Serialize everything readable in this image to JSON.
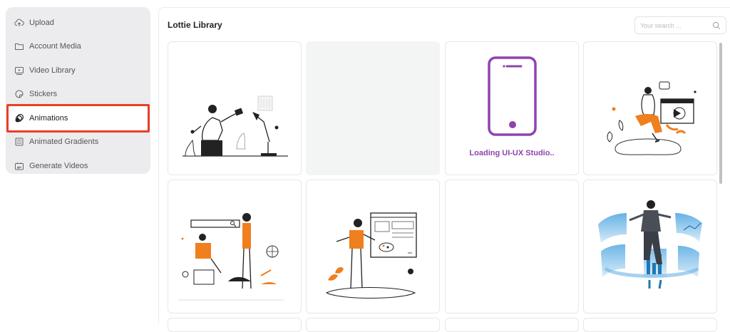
{
  "sidebar": {
    "items": [
      {
        "label": "Upload",
        "icon": "cloud-upload-icon"
      },
      {
        "label": "Account Media",
        "icon": "folder-icon"
      },
      {
        "label": "Video Library",
        "icon": "video-library-icon"
      },
      {
        "label": "Stickers",
        "icon": "sticker-icon"
      },
      {
        "label": "Animations",
        "icon": "animation-icon",
        "active": true
      },
      {
        "label": "Animated Gradients",
        "icon": "gradient-icon"
      },
      {
        "label": "Generate Videos",
        "icon": "generate-video-icon"
      }
    ]
  },
  "main": {
    "title": "Lottie Library",
    "search": {
      "placeholder": "Your search ..."
    },
    "cards": [
      {
        "kind": "illustration",
        "subject": "man-with-desk-lamp"
      },
      {
        "kind": "placeholder"
      },
      {
        "kind": "loading",
        "text": "Loading UI-UX Studio.."
      },
      {
        "kind": "illustration",
        "subject": "woman-with-video-player"
      },
      {
        "kind": "illustration",
        "subject": "two-people-with-search-bar"
      },
      {
        "kind": "illustration",
        "subject": "designer-with-palette"
      },
      {
        "kind": "empty"
      },
      {
        "kind": "illustration",
        "subject": "man-with-data-screens"
      }
    ]
  },
  "colors": {
    "accent_orange": "#f07f1e",
    "active_outline": "#ea3f25",
    "loading_purple": "#8e44ad",
    "sidebar_bg": "#ececee"
  }
}
